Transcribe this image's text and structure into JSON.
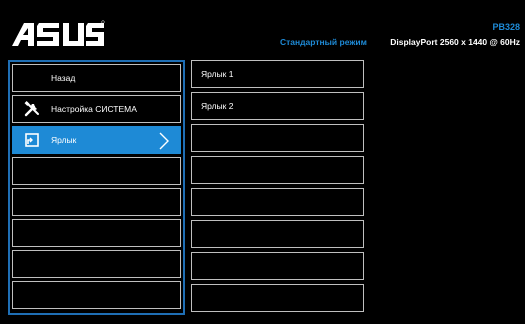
{
  "header": {
    "brand": "ASUS",
    "model": "PB328",
    "mode": "Стандартный режим",
    "signal": "DisplayPort 2560 x 1440 @ 60Hz"
  },
  "left_menu": {
    "items": [
      {
        "label": "Назад",
        "icon": ""
      },
      {
        "label": "Настройка СИСТЕМА",
        "icon": "wrench-screwdriver-icon"
      },
      {
        "label": "Ярлык",
        "icon": "shortcut-icon",
        "selected": true
      },
      {
        "label": ""
      },
      {
        "label": ""
      },
      {
        "label": ""
      },
      {
        "label": ""
      },
      {
        "label": ""
      }
    ]
  },
  "right_menu": {
    "items": [
      {
        "label": "Ярлык 1"
      },
      {
        "label": "Ярлык 2"
      },
      {
        "label": ""
      },
      {
        "label": ""
      },
      {
        "label": ""
      },
      {
        "label": ""
      },
      {
        "label": ""
      },
      {
        "label": ""
      }
    ]
  },
  "colors": {
    "accent": "#1e8ad6",
    "border": "#bfbfbf",
    "panel_border": "#1f6fb5",
    "background": "#000000"
  }
}
